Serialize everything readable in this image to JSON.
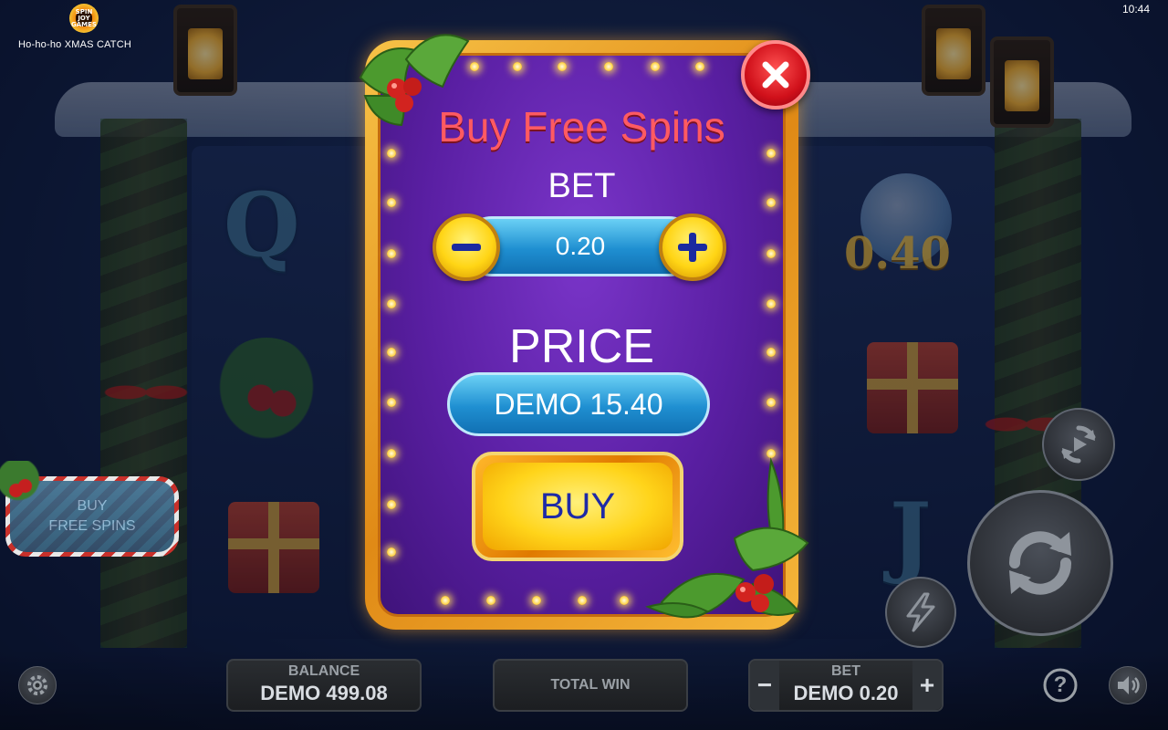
{
  "app": {
    "title": "Ho-ho-ho XMAS CATCH",
    "logo_text": "SPIN JOY GAMES",
    "clock": "10:44"
  },
  "modal": {
    "title": "Buy Free Spins",
    "bet_label": "BET",
    "bet_value": "0.20",
    "price_label": "PRICE",
    "price_value": "DEMO 15.40",
    "buy_label": "BUY",
    "close_icon": "close-icon"
  },
  "side": {
    "buy_free_spins_line1": "BUY",
    "buy_free_spins_line2": "FREE SPINS"
  },
  "bottom": {
    "balance_label": "BALANCE",
    "balance_value": "DEMO 499.08",
    "total_win_label": "TOTAL WIN",
    "total_win_value": "",
    "bet_label": "BET",
    "bet_value": "DEMO 0.20",
    "bet_minus": "−",
    "bet_plus": "+",
    "help": "?"
  },
  "background_symbols": {
    "q": "Q",
    "j": "J",
    "globe_value": "0.40"
  },
  "colors": {
    "title": "#ff5a62",
    "modal_bg": "#5a1fa3",
    "frame": "#f5b63a",
    "pill": "#1f8fd1",
    "buy_text": "#1e2aa6"
  }
}
